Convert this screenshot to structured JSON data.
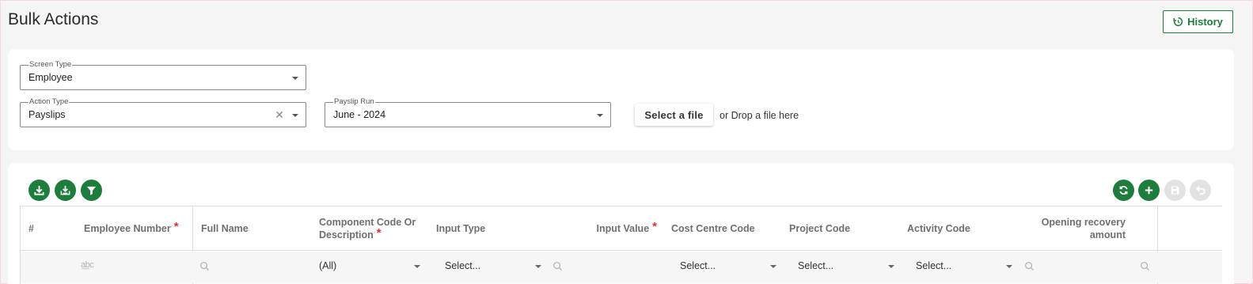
{
  "page": {
    "title": "Bulk Actions"
  },
  "header": {
    "history_label": "History"
  },
  "form": {
    "screen_type": {
      "label": "Screen Type",
      "value": "Employee"
    },
    "action_type": {
      "label": "Action Type",
      "value": "Payslips"
    },
    "payslip_run": {
      "label": "Payslip Run",
      "value": "June - 2024"
    },
    "file": {
      "button_label": "Select a file",
      "drop_text": "or Drop a file here"
    }
  },
  "toolbar": {
    "left": [
      "download-icon",
      "download-template-icon",
      "filter-icon"
    ],
    "right": [
      "refresh-icon",
      "add-icon",
      "save-icon",
      "undo-icon"
    ]
  },
  "grid": {
    "columns": [
      {
        "label": "#",
        "required": false
      },
      {
        "label": "Employee Number",
        "required": true
      },
      {
        "label": "Full Name",
        "required": false
      },
      {
        "label": "Component Code Or Description",
        "required": true
      },
      {
        "label": "Input Type",
        "required": false
      },
      {
        "label": "Input Value",
        "required": true
      },
      {
        "label": "Cost Centre Code",
        "required": false
      },
      {
        "label": "Project Code",
        "required": false
      },
      {
        "label": "Activity Code",
        "required": false
      },
      {
        "label": "Opening recovery amount",
        "required": false
      }
    ],
    "required_mark": "*",
    "filters": {
      "employee_number": "a͟bc",
      "component": "(All)",
      "input_type": "Select...",
      "cost_centre": "Select...",
      "project_code": "Select...",
      "activity_code": "Select..."
    }
  },
  "colors": {
    "accent": "#1e7d3c",
    "required": "#e0332f",
    "disabled": "#e2e2e2"
  }
}
